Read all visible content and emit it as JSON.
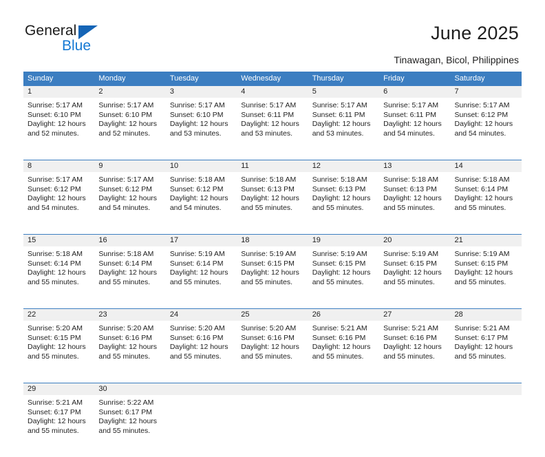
{
  "brand": {
    "name_top": "General",
    "name_bottom": "Blue",
    "triangle_color": "#1565b6",
    "blue_text_color": "#1579d4"
  },
  "header": {
    "title": "June 2025",
    "subtitle": "Tinawagan, Bicol, Philippines"
  },
  "theme": {
    "header_bg": "#3c7ec1",
    "header_text": "#ffffff",
    "daynum_band_bg": "#f0f0f0",
    "body_text": "#222222"
  },
  "calendar": {
    "weekday_headers": [
      "Sunday",
      "Monday",
      "Tuesday",
      "Wednesday",
      "Thursday",
      "Friday",
      "Saturday"
    ],
    "weeks": [
      [
        {
          "day": "1",
          "lines": [
            "Sunrise: 5:17 AM",
            "Sunset: 6:10 PM",
            "Daylight: 12 hours",
            "and 52 minutes."
          ]
        },
        {
          "day": "2",
          "lines": [
            "Sunrise: 5:17 AM",
            "Sunset: 6:10 PM",
            "Daylight: 12 hours",
            "and 52 minutes."
          ]
        },
        {
          "day": "3",
          "lines": [
            "Sunrise: 5:17 AM",
            "Sunset: 6:10 PM",
            "Daylight: 12 hours",
            "and 53 minutes."
          ]
        },
        {
          "day": "4",
          "lines": [
            "Sunrise: 5:17 AM",
            "Sunset: 6:11 PM",
            "Daylight: 12 hours",
            "and 53 minutes."
          ]
        },
        {
          "day": "5",
          "lines": [
            "Sunrise: 5:17 AM",
            "Sunset: 6:11 PM",
            "Daylight: 12 hours",
            "and 53 minutes."
          ]
        },
        {
          "day": "6",
          "lines": [
            "Sunrise: 5:17 AM",
            "Sunset: 6:11 PM",
            "Daylight: 12 hours",
            "and 54 minutes."
          ]
        },
        {
          "day": "7",
          "lines": [
            "Sunrise: 5:17 AM",
            "Sunset: 6:12 PM",
            "Daylight: 12 hours",
            "and 54 minutes."
          ]
        }
      ],
      [
        {
          "day": "8",
          "lines": [
            "Sunrise: 5:17 AM",
            "Sunset: 6:12 PM",
            "Daylight: 12 hours",
            "and 54 minutes."
          ]
        },
        {
          "day": "9",
          "lines": [
            "Sunrise: 5:17 AM",
            "Sunset: 6:12 PM",
            "Daylight: 12 hours",
            "and 54 minutes."
          ]
        },
        {
          "day": "10",
          "lines": [
            "Sunrise: 5:18 AM",
            "Sunset: 6:12 PM",
            "Daylight: 12 hours",
            "and 54 minutes."
          ]
        },
        {
          "day": "11",
          "lines": [
            "Sunrise: 5:18 AM",
            "Sunset: 6:13 PM",
            "Daylight: 12 hours",
            "and 55 minutes."
          ]
        },
        {
          "day": "12",
          "lines": [
            "Sunrise: 5:18 AM",
            "Sunset: 6:13 PM",
            "Daylight: 12 hours",
            "and 55 minutes."
          ]
        },
        {
          "day": "13",
          "lines": [
            "Sunrise: 5:18 AM",
            "Sunset: 6:13 PM",
            "Daylight: 12 hours",
            "and 55 minutes."
          ]
        },
        {
          "day": "14",
          "lines": [
            "Sunrise: 5:18 AM",
            "Sunset: 6:14 PM",
            "Daylight: 12 hours",
            "and 55 minutes."
          ]
        }
      ],
      [
        {
          "day": "15",
          "lines": [
            "Sunrise: 5:18 AM",
            "Sunset: 6:14 PM",
            "Daylight: 12 hours",
            "and 55 minutes."
          ]
        },
        {
          "day": "16",
          "lines": [
            "Sunrise: 5:18 AM",
            "Sunset: 6:14 PM",
            "Daylight: 12 hours",
            "and 55 minutes."
          ]
        },
        {
          "day": "17",
          "lines": [
            "Sunrise: 5:19 AM",
            "Sunset: 6:14 PM",
            "Daylight: 12 hours",
            "and 55 minutes."
          ]
        },
        {
          "day": "18",
          "lines": [
            "Sunrise: 5:19 AM",
            "Sunset: 6:15 PM",
            "Daylight: 12 hours",
            "and 55 minutes."
          ]
        },
        {
          "day": "19",
          "lines": [
            "Sunrise: 5:19 AM",
            "Sunset: 6:15 PM",
            "Daylight: 12 hours",
            "and 55 minutes."
          ]
        },
        {
          "day": "20",
          "lines": [
            "Sunrise: 5:19 AM",
            "Sunset: 6:15 PM",
            "Daylight: 12 hours",
            "and 55 minutes."
          ]
        },
        {
          "day": "21",
          "lines": [
            "Sunrise: 5:19 AM",
            "Sunset: 6:15 PM",
            "Daylight: 12 hours",
            "and 55 minutes."
          ]
        }
      ],
      [
        {
          "day": "22",
          "lines": [
            "Sunrise: 5:20 AM",
            "Sunset: 6:15 PM",
            "Daylight: 12 hours",
            "and 55 minutes."
          ]
        },
        {
          "day": "23",
          "lines": [
            "Sunrise: 5:20 AM",
            "Sunset: 6:16 PM",
            "Daylight: 12 hours",
            "and 55 minutes."
          ]
        },
        {
          "day": "24",
          "lines": [
            "Sunrise: 5:20 AM",
            "Sunset: 6:16 PM",
            "Daylight: 12 hours",
            "and 55 minutes."
          ]
        },
        {
          "day": "25",
          "lines": [
            "Sunrise: 5:20 AM",
            "Sunset: 6:16 PM",
            "Daylight: 12 hours",
            "and 55 minutes."
          ]
        },
        {
          "day": "26",
          "lines": [
            "Sunrise: 5:21 AM",
            "Sunset: 6:16 PM",
            "Daylight: 12 hours",
            "and 55 minutes."
          ]
        },
        {
          "day": "27",
          "lines": [
            "Sunrise: 5:21 AM",
            "Sunset: 6:16 PM",
            "Daylight: 12 hours",
            "and 55 minutes."
          ]
        },
        {
          "day": "28",
          "lines": [
            "Sunrise: 5:21 AM",
            "Sunset: 6:17 PM",
            "Daylight: 12 hours",
            "and 55 minutes."
          ]
        }
      ],
      [
        {
          "day": "29",
          "lines": [
            "Sunrise: 5:21 AM",
            "Sunset: 6:17 PM",
            "Daylight: 12 hours",
            "and 55 minutes."
          ]
        },
        {
          "day": "30",
          "lines": [
            "Sunrise: 5:22 AM",
            "Sunset: 6:17 PM",
            "Daylight: 12 hours",
            "and 55 minutes."
          ]
        },
        {
          "day": "",
          "lines": []
        },
        {
          "day": "",
          "lines": []
        },
        {
          "day": "",
          "lines": []
        },
        {
          "day": "",
          "lines": []
        },
        {
          "day": "",
          "lines": []
        }
      ]
    ]
  }
}
